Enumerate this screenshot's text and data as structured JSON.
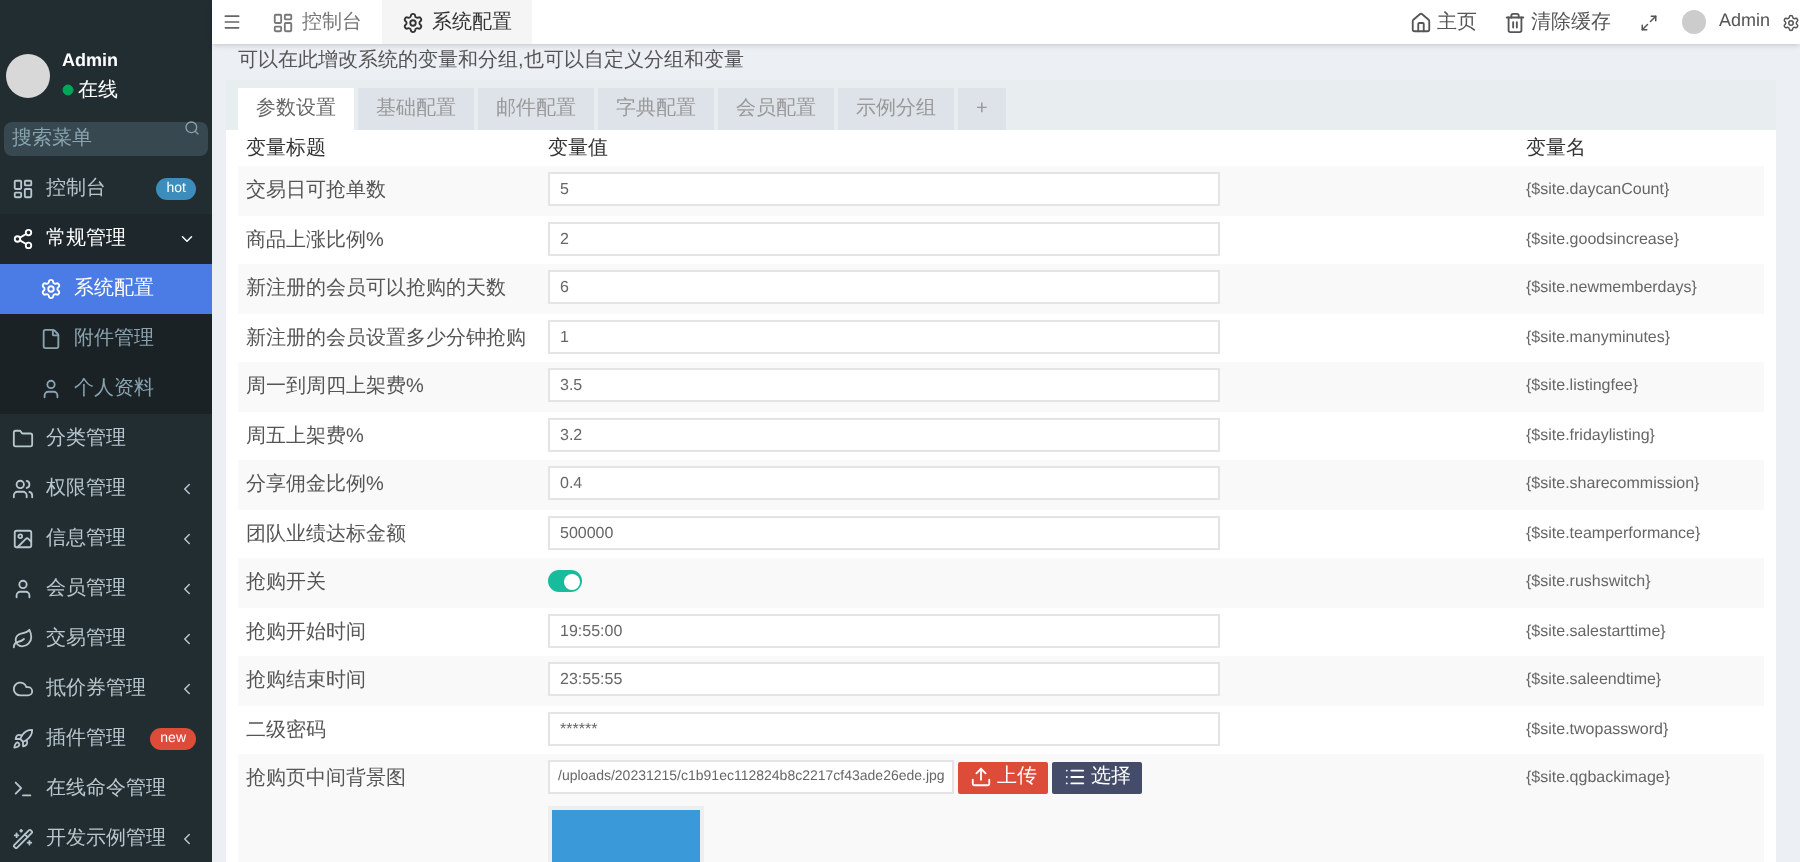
{
  "sidebar": {
    "user": {
      "name": "Admin",
      "status": "在线",
      "online": true
    },
    "search": {
      "placeholder": "搜索菜单"
    },
    "items": [
      {
        "label": "控制台",
        "badge": "hot",
        "selected": false
      },
      {
        "label": "常规管理",
        "expanded": true,
        "selected": false,
        "children": [
          {
            "label": "系统配置",
            "selected": true
          },
          {
            "label": "附件管理",
            "selected": false
          },
          {
            "label": "个人资料",
            "selected": false
          }
        ]
      },
      {
        "label": "分类管理",
        "selected": false
      },
      {
        "label": "权限管理",
        "expanded": false,
        "selected": false
      },
      {
        "label": "信息管理",
        "expanded": false,
        "selected": false
      },
      {
        "label": "会员管理",
        "expanded": false,
        "selected": false
      },
      {
        "label": "交易管理",
        "expanded": false,
        "selected": false
      },
      {
        "label": "抵价券管理",
        "expanded": false,
        "selected": false
      },
      {
        "label": "插件管理",
        "badge": "new",
        "selected": false
      },
      {
        "label": "在线命令管理",
        "selected": false
      },
      {
        "label": "开发示例管理",
        "expanded": false,
        "selected": false
      }
    ]
  },
  "topbar": {
    "tabs": [
      {
        "label": "控制台",
        "selected": false
      },
      {
        "label": "系统配置",
        "selected": true
      }
    ],
    "links": [
      "主页",
      "清除缓存"
    ],
    "user": "Admin"
  },
  "description": "可以在此增改系统的变量和分组,也可以自定义分组和变量",
  "config_tabs": [
    {
      "label": "参数设置",
      "selected": true
    },
    {
      "label": "基础配置",
      "selected": false
    },
    {
      "label": "邮件配置",
      "selected": false
    },
    {
      "label": "字典配置",
      "selected": false
    },
    {
      "label": "会员配置",
      "selected": false
    },
    {
      "label": "示例分组",
      "selected": false
    },
    {
      "label": "+",
      "selected": false
    }
  ],
  "table": {
    "columns": [
      "变量标题",
      "变量值",
      "变量名"
    ],
    "rows": [
      {
        "kind": "text",
        "title": "交易日可抢单数",
        "value": "5",
        "name": "{$site.daycanCount}"
      },
      {
        "kind": "text",
        "title": "商品上涨比例%",
        "value": "2",
        "name": "{$site.goodsincrease}"
      },
      {
        "kind": "text",
        "title": "新注册的会员可以抢购的天数",
        "value": "6",
        "name": "{$site.newmemberdays}"
      },
      {
        "kind": "text",
        "title": "新注册的会员设置多少分钟抢购",
        "value": "1",
        "name": "{$site.manyminutes}"
      },
      {
        "kind": "text",
        "title": "周一到周四上架费%",
        "value": "3.5",
        "name": "{$site.listingfee}"
      },
      {
        "kind": "text",
        "title": "周五上架费%",
        "value": "3.2",
        "name": "{$site.fridaylisting}"
      },
      {
        "kind": "text",
        "title": "分享佣金比例%",
        "value": "0.4",
        "name": "{$site.sharecommission}"
      },
      {
        "kind": "text",
        "title": "团队业绩达标金额",
        "value": "500000",
        "name": "{$site.teamperformance}"
      },
      {
        "kind": "switch",
        "title": "抢购开关",
        "on": true,
        "name": "{$site.rushswitch}"
      },
      {
        "kind": "text",
        "title": "抢购开始时间",
        "value": "19:55:00",
        "name": "{$site.salestarttime}"
      },
      {
        "kind": "text",
        "title": "抢购结束时间",
        "value": "23:55:55",
        "name": "{$site.saleendtime}"
      },
      {
        "kind": "text",
        "title": "二级密码",
        "value": "******",
        "name": "{$site.twopassword}"
      },
      {
        "kind": "image",
        "title": "抢购页中间背景图",
        "value": "/uploads/20231215/c1b91ec112824b8c2217cf43ade26ede.jpg",
        "name": "{$site.qgbackimage}",
        "buttons": [
          "上传",
          "选择"
        ]
      }
    ]
  }
}
